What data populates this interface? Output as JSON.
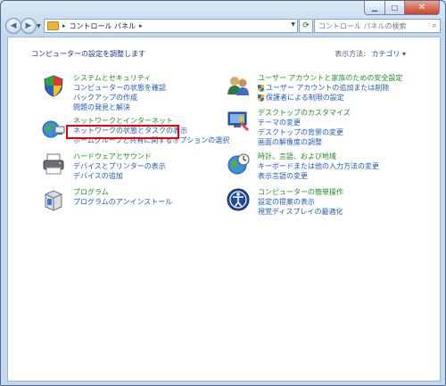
{
  "navbar": {
    "breadcrumb_sep": "▸",
    "breadcrumb": "コントロール パネル",
    "search_placeholder": "コントロール パネルの検索"
  },
  "header": {
    "title": "コンピューターの設定を調整します",
    "view_by_label": "表示方法:",
    "view_by_value": "カテゴリ ▾"
  },
  "categories_left": [
    {
      "title": "システムとセキュリティ",
      "links": [
        "コンピューターの状態を確認",
        "バックアップの作成",
        "問題の発見と解決"
      ]
    },
    {
      "title": "ネットワークとインターネット",
      "links": [
        "ネットワークの状態とタスクの表示",
        "ホームグループと共有に関するオプションの選択"
      ]
    },
    {
      "title": "ハードウェアとサウンド",
      "links": [
        "デバイスとプリンターの表示",
        "デバイスの追加"
      ]
    },
    {
      "title": "プログラム",
      "links": [
        "プログラムのアンインストール"
      ]
    }
  ],
  "categories_right": [
    {
      "title": "ユーザー アカウントと家族のための安全設定",
      "links": [
        "ユーザー アカウントの追加または削除",
        "保護者による制限の設定"
      ]
    },
    {
      "title": "デスクトップのカスタマイズ",
      "links": [
        "テーマの変更",
        "デスクトップの背景の変更",
        "画面の解像度の調整"
      ]
    },
    {
      "title": "時計、言語、および地域",
      "links": [
        "キーボードまたは他の入力方法の変更",
        "表示言語の変更"
      ]
    },
    {
      "title": "コンピューターの簡単操作",
      "links": [
        "設定の提案の表示",
        "視覚ディスプレイの最適化"
      ]
    }
  ],
  "colors": {
    "category_title": "#1e8c22",
    "link": "#1e5ab7",
    "highlight_box": "#e60000"
  }
}
